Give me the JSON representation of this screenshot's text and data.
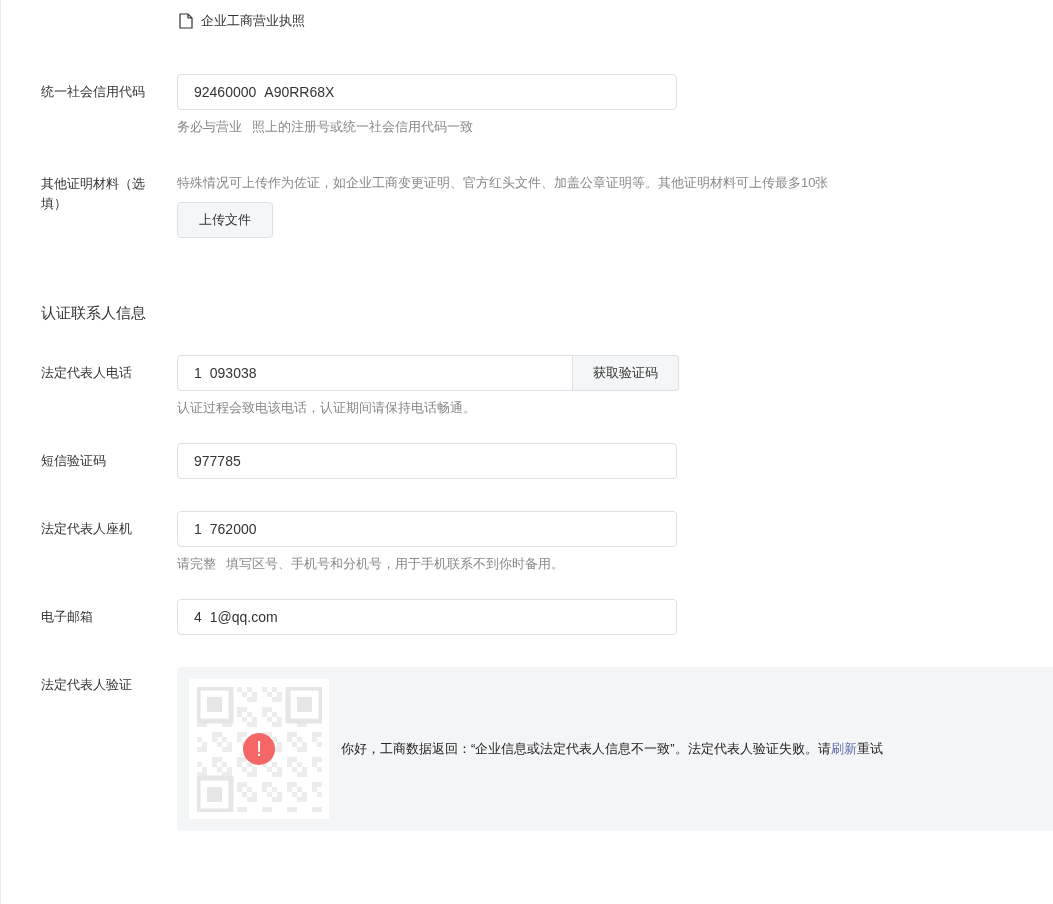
{
  "license_file": {
    "name": "企业工商营业执照"
  },
  "credit_code": {
    "label": "统一社会信用代码",
    "value_parts": [
      "92460000",
      "A90RR68X"
    ],
    "hint_parts": [
      "务必与营业",
      "照上的注册号或统一社会信用代码一致"
    ]
  },
  "other_materials": {
    "label": "其他证明材料（选填）",
    "hint": "特殊情况可上传作为佐证，如企业工商变更证明、官方红头文件、加盖公章证明等。其他证明材料可上传最多10张",
    "upload_button": "上传文件"
  },
  "contact_section": {
    "title": "认证联系人信息"
  },
  "fields": [
    {
      "kind": "phone",
      "label": "法定代表人电话",
      "value_parts": [
        "1",
        "093038"
      ],
      "button": "获取验证码",
      "hint_parts": [
        "认证过程会致电该电话，认证期间请保持电话畅通。"
      ]
    },
    {
      "kind": "text",
      "label": "短信验证码",
      "value_parts": [
        "977785"
      ]
    },
    {
      "kind": "text",
      "label": "法定代表人座机",
      "value_parts": [
        "1",
        "762000"
      ],
      "hint_parts": [
        "请完整",
        "填写区号、手机号和分机号，用于手机联系不到你时备用。"
      ]
    },
    {
      "kind": "text",
      "label": "电子邮箱",
      "value_parts": [
        "4",
        "1@qq.com"
      ]
    }
  ],
  "verification": {
    "label": "法定代表人验证",
    "error_icon": "!",
    "message_before": "你好，工商数据返回：“企业信息或法定代表人信息不一致”。法定代表人验证失败。请",
    "link": "刷新",
    "message_after": "重试"
  }
}
